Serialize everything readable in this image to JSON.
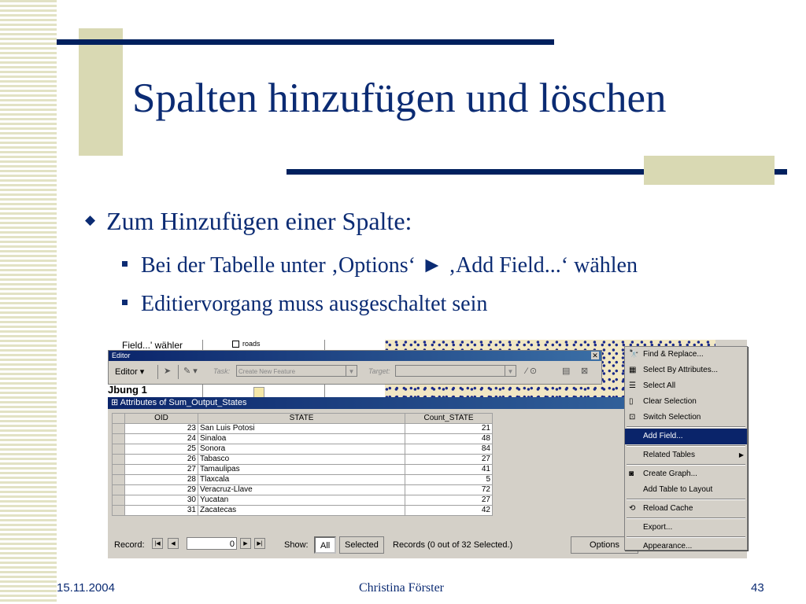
{
  "slide": {
    "title": "Spalten hinzufügen und löschen",
    "bullet1": "Zum Hinzufügen einer Spalte:",
    "sub1": "Bei der Tabelle unter ‚Options‘ ► ‚Add Field...‘ wählen",
    "sub2": "Editiervorgang muss ausgeschaltet sein"
  },
  "screenshot": {
    "toc_field_text": "Field...' wähler",
    "toc_roads": "roads",
    "toc_ubung": "Jbung 1",
    "editor": {
      "title": "Editor",
      "menu_label": "Editor ▾",
      "task_label": "Task:",
      "task_value": "Create New Feature",
      "target_label": "Target:",
      "target_value": ""
    },
    "attributes": {
      "title": "Attributes of Sum_Output_States",
      "columns": [
        "OID",
        "STATE",
        "Count_STATE"
      ],
      "rows": [
        [
          "23",
          "San Luis Potosi",
          "21"
        ],
        [
          "24",
          "Sinaloa",
          "48"
        ],
        [
          "25",
          "Sonora",
          "84"
        ],
        [
          "26",
          "Tabasco",
          "27"
        ],
        [
          "27",
          "Tamaulipas",
          "41"
        ],
        [
          "28",
          "Tlaxcala",
          "5"
        ],
        [
          "29",
          "Veracruz-Llave",
          "72"
        ],
        [
          "30",
          "Yucatan",
          "27"
        ],
        [
          "31",
          "Zacatecas",
          "42"
        ]
      ],
      "record_label": "Record:",
      "record_value": "0",
      "show_label": "Show:",
      "show_all": "All",
      "show_selected": "Selected",
      "records_text": "Records   (0 out of 32 Selected.)",
      "options_label": "Options"
    },
    "options_menu": [
      {
        "label": "Find & Replace...",
        "icon": "binoculars-icon"
      },
      {
        "label": "Select By Attributes...",
        "icon": "sql-icon"
      },
      {
        "label": "Select All",
        "icon": "select-all-icon"
      },
      {
        "label": "Clear Selection",
        "icon": "clear-selection-icon"
      },
      {
        "label": "Switch Selection",
        "icon": "switch-selection-icon"
      },
      {
        "label": "Add Field...",
        "icon": "",
        "highlighted": true
      },
      {
        "label": "Related Tables",
        "icon": "",
        "submenu": true
      },
      {
        "label": "Create Graph...",
        "icon": "graph-icon"
      },
      {
        "label": "Add Table to Layout",
        "icon": ""
      },
      {
        "label": "Reload Cache",
        "icon": "reload-icon"
      },
      {
        "label": "Export...",
        "icon": ""
      },
      {
        "label": "Appearance...",
        "icon": ""
      }
    ]
  },
  "footer": {
    "date": "15.11.2004",
    "author": "Christina Förster",
    "page": "43"
  },
  "colors": {
    "text": "#0b2b73",
    "navy_bar": "#00205e",
    "beige": "#d9d9b3",
    "menu_highlight": "#0a246a"
  }
}
